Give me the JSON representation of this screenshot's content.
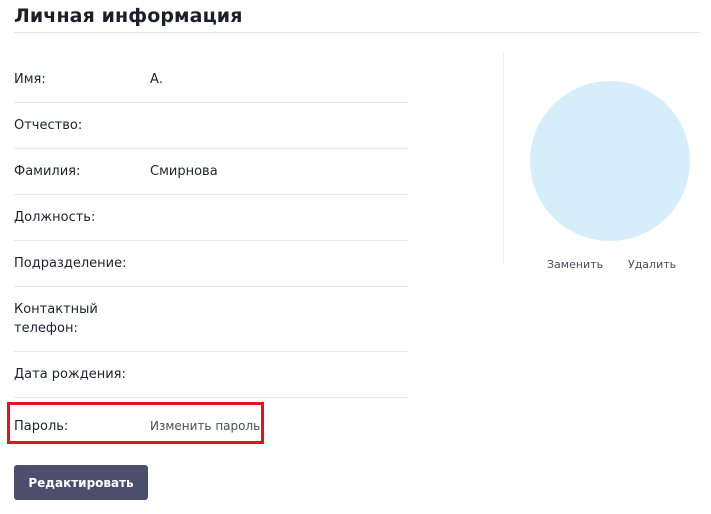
{
  "page": {
    "title": "Личная информация"
  },
  "fields": [
    {
      "label": "Имя:",
      "value": "А."
    },
    {
      "label": "Отчество:",
      "value": ""
    },
    {
      "label": "Фамилия:",
      "value": "Смирнова"
    },
    {
      "label": "Должность:",
      "value": ""
    },
    {
      "label": "Подразделение:",
      "value": ""
    },
    {
      "label": "Контактный телефон:",
      "value": ""
    },
    {
      "label": "Дата рождения:",
      "value": ""
    }
  ],
  "password": {
    "label": "Пароль:",
    "link": "Изменить пароль"
  },
  "actions": {
    "edit_label": "Редактировать"
  },
  "avatar": {
    "replace_label": "Заменить",
    "delete_label": "Удалить",
    "color": "#d6eefa"
  },
  "colors": {
    "button": "#4b4e6c",
    "highlight": "#e0161b"
  }
}
